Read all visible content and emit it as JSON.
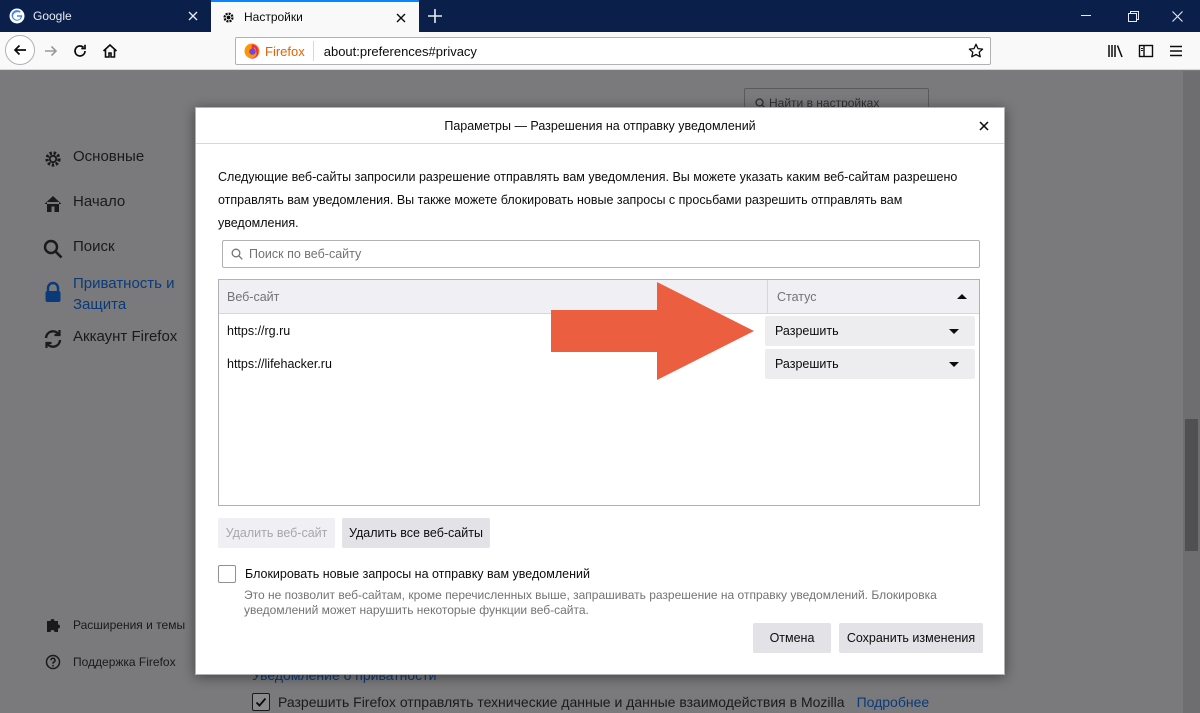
{
  "tabs": [
    {
      "label": "Google",
      "icon": "google-icon"
    },
    {
      "label": "Настройки",
      "icon": "gear-icon"
    }
  ],
  "navbar": {
    "identity_label": "Firefox",
    "url": "about:preferences#privacy"
  },
  "preferences": {
    "search_placeholder": "Найти в настройках",
    "sidebar": [
      {
        "label": "Основные",
        "icon": "gear-icon"
      },
      {
        "label": "Начало",
        "icon": "home-icon"
      },
      {
        "label": "Поиск",
        "icon": "search-icon"
      },
      {
        "label": "Приватность и Защита",
        "line1": "Приватность и",
        "line2": "Защита",
        "icon": "lock-icon",
        "selected": true
      },
      {
        "label": "Аккаунт Firefox",
        "icon": "sync-icon"
      }
    ],
    "footer_links": [
      {
        "label": "Расширения и темы",
        "icon": "puzzle-icon"
      },
      {
        "label": "Поддержка Firefox",
        "icon": "help-icon"
      }
    ],
    "notice_link": "Уведомление о приватности",
    "telemetry_checkbox": "Разрешить Firefox отправлять технические данные и данные взаимодействия в Mozilla",
    "more_link": "Подробнее"
  },
  "dialog": {
    "title": "Параметры — Разрешения на отправку уведомлений",
    "description_lines": [
      "Следующие веб-сайты запросили разрешение отправлять вам уведомления. Вы можете указать каким веб-сайтам разрешено",
      "отправлять вам уведомления. Вы также можете блокировать новые запросы с просьбами разрешить отправлять вам",
      "уведомления."
    ],
    "search_placeholder": "Поиск по веб-сайту",
    "columns": {
      "site": "Веб-сайт",
      "status": "Статус"
    },
    "rows": [
      {
        "site": "https://rg.ru",
        "status": "Разрешить"
      },
      {
        "site": "https://lifehacker.ru",
        "status": "Разрешить"
      }
    ],
    "remove_site": "Удалить веб-сайт",
    "remove_all": "Удалить все веб-сайты",
    "block_label": "Блокировать новые запросы на отправку вам уведомлений",
    "block_note_lines": [
      "Это не позволит веб-сайтам, кроме перечисленных выше, запрашивать разрешение на отправку уведомлений. Блокировка",
      "уведомлений может нарушить некоторые функции веб-сайта."
    ],
    "cancel": "Отмена",
    "save": "Сохранить изменения"
  },
  "colors": {
    "accent": "#0a84ff",
    "tabstrip": "#0b1f4b",
    "arrow": "#eb5e40",
    "firefox_orange": "#e66000"
  }
}
